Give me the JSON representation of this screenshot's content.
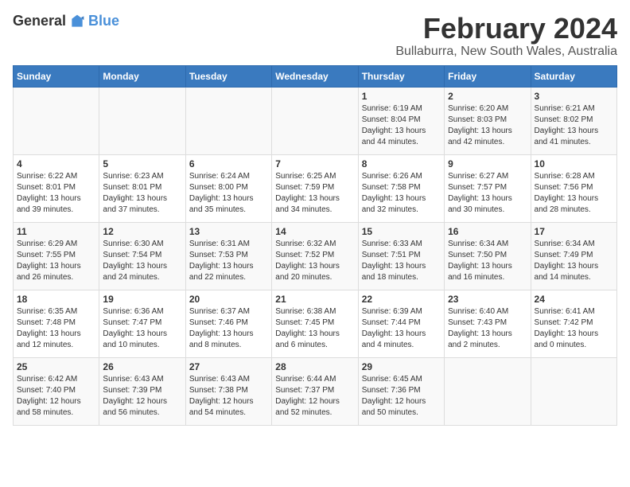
{
  "logo": {
    "general": "General",
    "blue": "Blue"
  },
  "header": {
    "title": "February 2024",
    "subtitle": "Bullaburra, New South Wales, Australia"
  },
  "weekdays": [
    "Sunday",
    "Monday",
    "Tuesday",
    "Wednesday",
    "Thursday",
    "Friday",
    "Saturday"
  ],
  "weeks": [
    [
      {
        "day": "",
        "info": ""
      },
      {
        "day": "",
        "info": ""
      },
      {
        "day": "",
        "info": ""
      },
      {
        "day": "",
        "info": ""
      },
      {
        "day": "1",
        "info": "Sunrise: 6:19 AM\nSunset: 8:04 PM\nDaylight: 13 hours\nand 44 minutes."
      },
      {
        "day": "2",
        "info": "Sunrise: 6:20 AM\nSunset: 8:03 PM\nDaylight: 13 hours\nand 42 minutes."
      },
      {
        "day": "3",
        "info": "Sunrise: 6:21 AM\nSunset: 8:02 PM\nDaylight: 13 hours\nand 41 minutes."
      }
    ],
    [
      {
        "day": "4",
        "info": "Sunrise: 6:22 AM\nSunset: 8:01 PM\nDaylight: 13 hours\nand 39 minutes."
      },
      {
        "day": "5",
        "info": "Sunrise: 6:23 AM\nSunset: 8:01 PM\nDaylight: 13 hours\nand 37 minutes."
      },
      {
        "day": "6",
        "info": "Sunrise: 6:24 AM\nSunset: 8:00 PM\nDaylight: 13 hours\nand 35 minutes."
      },
      {
        "day": "7",
        "info": "Sunrise: 6:25 AM\nSunset: 7:59 PM\nDaylight: 13 hours\nand 34 minutes."
      },
      {
        "day": "8",
        "info": "Sunrise: 6:26 AM\nSunset: 7:58 PM\nDaylight: 13 hours\nand 32 minutes."
      },
      {
        "day": "9",
        "info": "Sunrise: 6:27 AM\nSunset: 7:57 PM\nDaylight: 13 hours\nand 30 minutes."
      },
      {
        "day": "10",
        "info": "Sunrise: 6:28 AM\nSunset: 7:56 PM\nDaylight: 13 hours\nand 28 minutes."
      }
    ],
    [
      {
        "day": "11",
        "info": "Sunrise: 6:29 AM\nSunset: 7:55 PM\nDaylight: 13 hours\nand 26 minutes."
      },
      {
        "day": "12",
        "info": "Sunrise: 6:30 AM\nSunset: 7:54 PM\nDaylight: 13 hours\nand 24 minutes."
      },
      {
        "day": "13",
        "info": "Sunrise: 6:31 AM\nSunset: 7:53 PM\nDaylight: 13 hours\nand 22 minutes."
      },
      {
        "day": "14",
        "info": "Sunrise: 6:32 AM\nSunset: 7:52 PM\nDaylight: 13 hours\nand 20 minutes."
      },
      {
        "day": "15",
        "info": "Sunrise: 6:33 AM\nSunset: 7:51 PM\nDaylight: 13 hours\nand 18 minutes."
      },
      {
        "day": "16",
        "info": "Sunrise: 6:34 AM\nSunset: 7:50 PM\nDaylight: 13 hours\nand 16 minutes."
      },
      {
        "day": "17",
        "info": "Sunrise: 6:34 AM\nSunset: 7:49 PM\nDaylight: 13 hours\nand 14 minutes."
      }
    ],
    [
      {
        "day": "18",
        "info": "Sunrise: 6:35 AM\nSunset: 7:48 PM\nDaylight: 13 hours\nand 12 minutes."
      },
      {
        "day": "19",
        "info": "Sunrise: 6:36 AM\nSunset: 7:47 PM\nDaylight: 13 hours\nand 10 minutes."
      },
      {
        "day": "20",
        "info": "Sunrise: 6:37 AM\nSunset: 7:46 PM\nDaylight: 13 hours\nand 8 minutes."
      },
      {
        "day": "21",
        "info": "Sunrise: 6:38 AM\nSunset: 7:45 PM\nDaylight: 13 hours\nand 6 minutes."
      },
      {
        "day": "22",
        "info": "Sunrise: 6:39 AM\nSunset: 7:44 PM\nDaylight: 13 hours\nand 4 minutes."
      },
      {
        "day": "23",
        "info": "Sunrise: 6:40 AM\nSunset: 7:43 PM\nDaylight: 13 hours\nand 2 minutes."
      },
      {
        "day": "24",
        "info": "Sunrise: 6:41 AM\nSunset: 7:42 PM\nDaylight: 13 hours\nand 0 minutes."
      }
    ],
    [
      {
        "day": "25",
        "info": "Sunrise: 6:42 AM\nSunset: 7:40 PM\nDaylight: 12 hours\nand 58 minutes."
      },
      {
        "day": "26",
        "info": "Sunrise: 6:43 AM\nSunset: 7:39 PM\nDaylight: 12 hours\nand 56 minutes."
      },
      {
        "day": "27",
        "info": "Sunrise: 6:43 AM\nSunset: 7:38 PM\nDaylight: 12 hours\nand 54 minutes."
      },
      {
        "day": "28",
        "info": "Sunrise: 6:44 AM\nSunset: 7:37 PM\nDaylight: 12 hours\nand 52 minutes."
      },
      {
        "day": "29",
        "info": "Sunrise: 6:45 AM\nSunset: 7:36 PM\nDaylight: 12 hours\nand 50 minutes."
      },
      {
        "day": "",
        "info": ""
      },
      {
        "day": "",
        "info": ""
      }
    ]
  ]
}
